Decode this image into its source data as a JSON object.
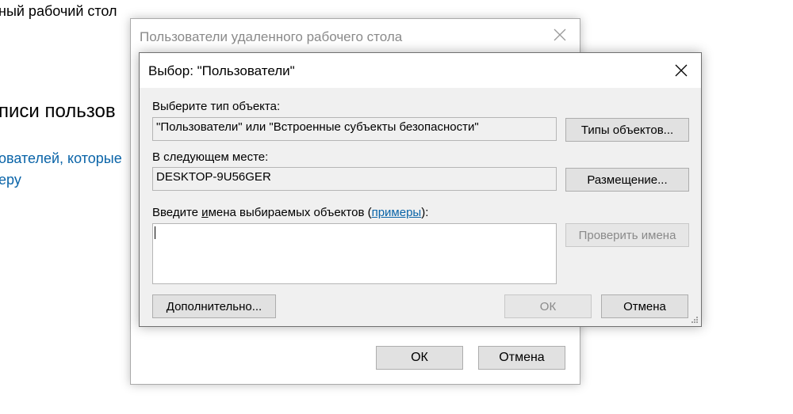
{
  "background": {
    "header_fragment": "ный рабочий стол",
    "section_title_fragment": "писи пользов",
    "link_line_1": "ователей, которые",
    "link_line_2": "еру"
  },
  "parent_dialog": {
    "title": "Пользователи удаленного рабочего стола",
    "ok_label": "ОК",
    "cancel_label": "Отмена"
  },
  "select_dialog": {
    "title": "Выбор: \"Пользователи\"",
    "object_type_label": "Выберите тип объекта:",
    "object_type_value": "\"Пользователи\" или \"Встроенные субъекты безопасности\"",
    "object_types_button": "Типы объектов...",
    "location_label": "В следующем месте:",
    "location_value": "DESKTOP-9U56GER",
    "location_button": "Размещение...",
    "names_label_prefix": "Введите ",
    "names_label_underlined": "и",
    "names_label_middle": "мена выбираемых объектов (",
    "names_label_link": "примеры",
    "names_label_suffix": "):",
    "names_value": "",
    "check_names_button": "Проверить имена",
    "advanced_button": "Дополнительно...",
    "ok_button": "ОК",
    "cancel_button": "Отмена"
  },
  "colors": {
    "link": "#0a64a8",
    "dialog_bg": "#f0f0f0",
    "button_bg": "#e1e1e1",
    "disabled_text": "#8a8a8a"
  },
  "icons": {
    "close": "close-icon",
    "resize": "resize-grip-icon"
  }
}
